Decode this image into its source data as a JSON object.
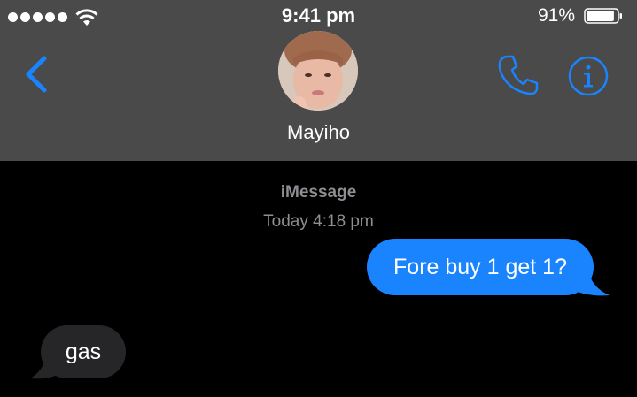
{
  "status_bar": {
    "signal_bars": 5,
    "wifi_icon": "wifi-icon",
    "time": "9:41 pm",
    "battery_percent": "91%",
    "battery_level": 0.91
  },
  "nav": {
    "back_icon": "chevron-left-icon",
    "contact_name": "Mayiho",
    "avatar_icon": "contact-avatar",
    "phone_icon": "phone-icon",
    "info_icon": "info-icon",
    "accent_color": "#1a84ff"
  },
  "conversation": {
    "service": "iMessage",
    "timestamp": "Today 4:18 pm",
    "messages": [
      {
        "direction": "outgoing",
        "text": "Fore buy 1 get 1?",
        "color": "#1a84ff"
      },
      {
        "direction": "incoming",
        "text": "gas",
        "color": "#262628"
      }
    ]
  }
}
